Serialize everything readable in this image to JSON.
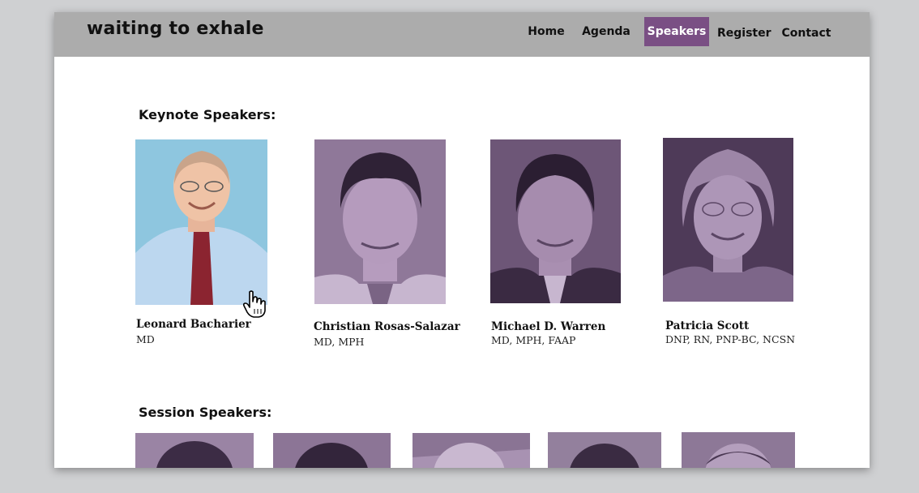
{
  "site": {
    "title": "waiting to exhale"
  },
  "nav": {
    "items": [
      {
        "label": "Home"
      },
      {
        "label": "Agenda"
      },
      {
        "label": "Speakers"
      },
      {
        "label": "Register"
      },
      {
        "label": "Contact"
      }
    ],
    "active": "Speakers"
  },
  "keynote": {
    "heading": "Keynote Speakers:",
    "speakers": [
      {
        "name": "Leonard Bacharier",
        "credentials": "MD"
      },
      {
        "name": "Christian Rosas-Salazar",
        "credentials": "MD, MPH"
      },
      {
        "name": "Michael D. Warren",
        "credentials": "MD, MPH, FAAP"
      },
      {
        "name": "Patricia Scott",
        "credentials": "DNP, RN, PNP-BC, NCSN"
      }
    ]
  },
  "session": {
    "heading": "Session Speakers:"
  },
  "colors": {
    "navbar": "#acacac",
    "accent": "#7a4f84",
    "photo_tint": "#8c7498",
    "background": "#cfd0d2"
  }
}
